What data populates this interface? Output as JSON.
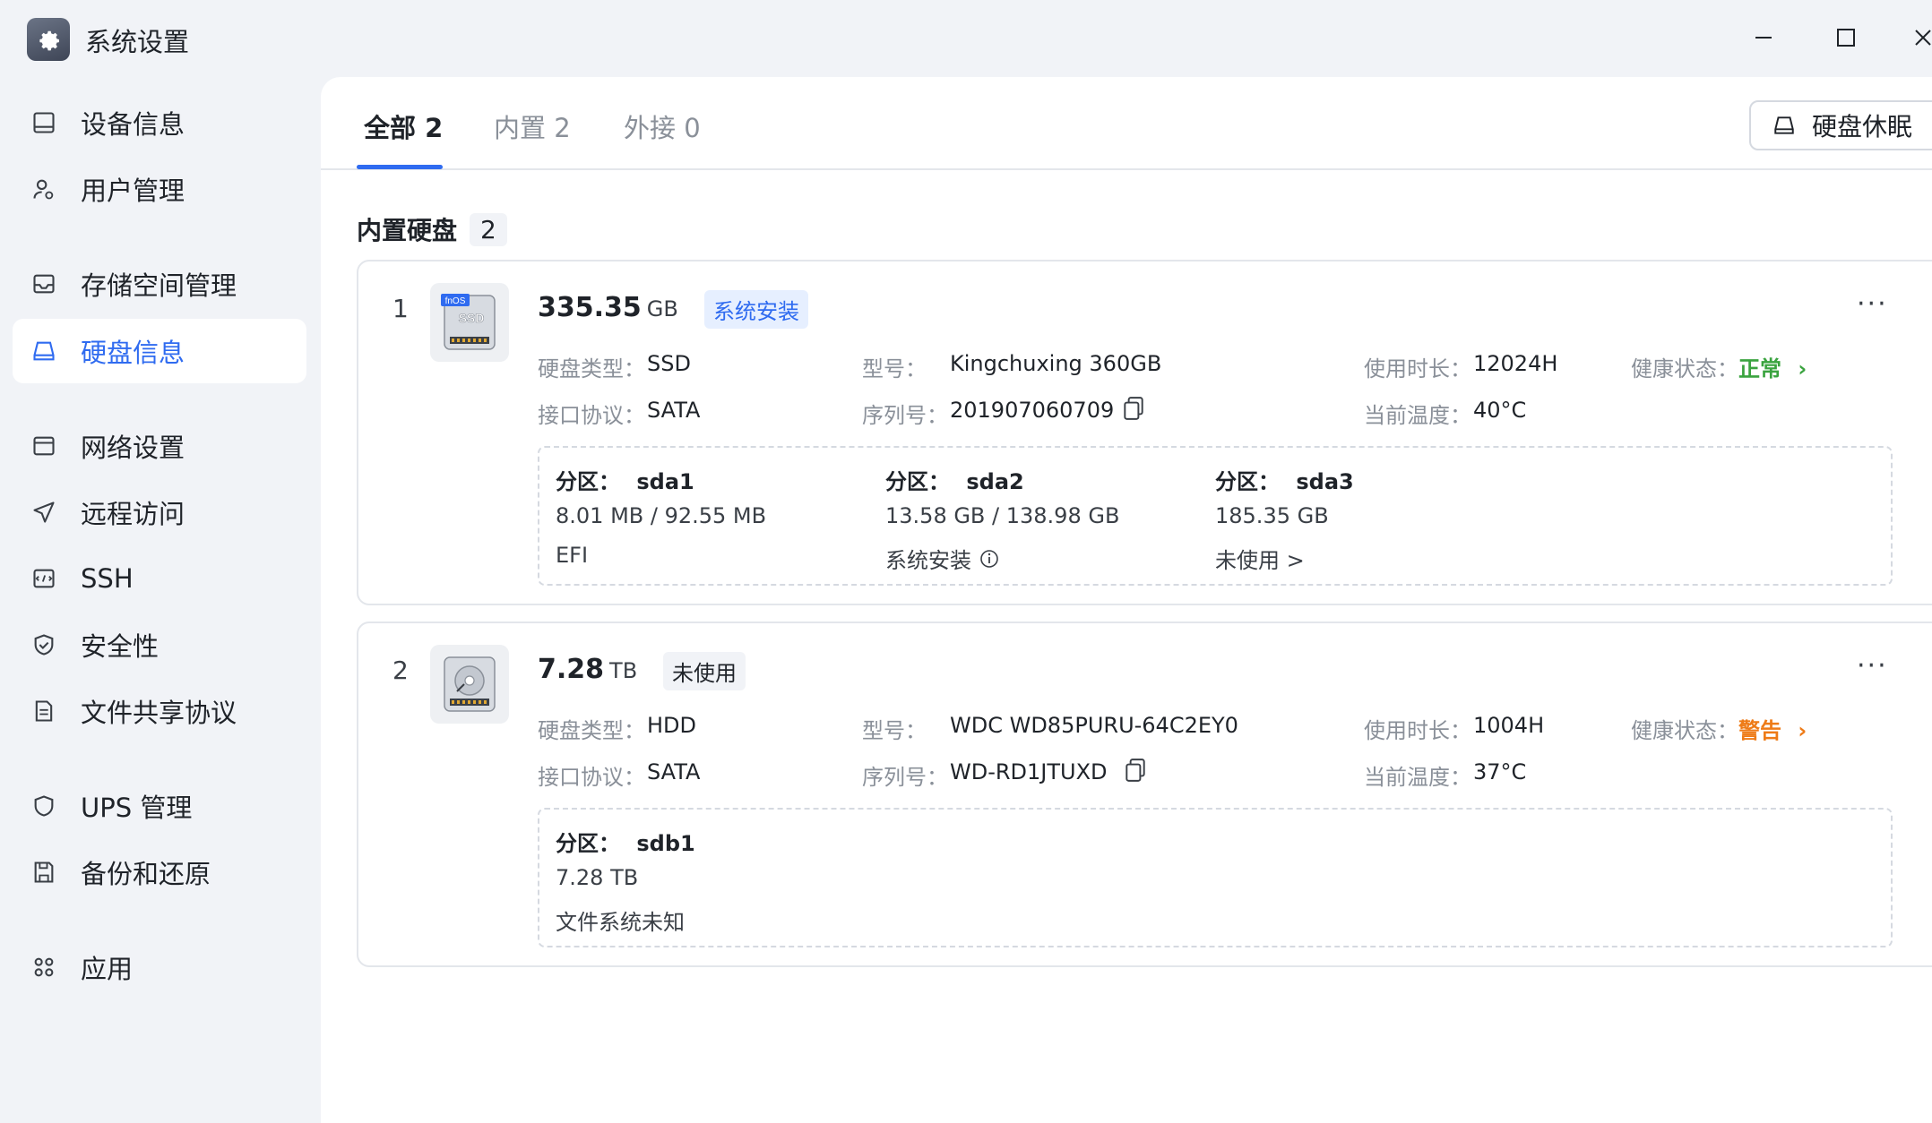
{
  "window": {
    "title": "系统设置"
  },
  "sidebar": {
    "items": [
      {
        "label": "设备信息",
        "icon": "monitor-icon"
      },
      {
        "label": "用户管理",
        "icon": "user-icon"
      },
      {
        "label": "存储空间管理",
        "icon": "storage-icon"
      },
      {
        "label": "硬盘信息",
        "icon": "disk-icon",
        "active": true
      },
      {
        "label": "网络设置",
        "icon": "network-icon"
      },
      {
        "label": "远程访问",
        "icon": "send-icon"
      },
      {
        "label": "SSH",
        "icon": "terminal-icon"
      },
      {
        "label": "安全性",
        "icon": "shield-check-icon"
      },
      {
        "label": "文件共享协议",
        "icon": "document-icon"
      },
      {
        "label": "UPS 管理",
        "icon": "shield-icon"
      },
      {
        "label": "备份和还原",
        "icon": "backup-icon"
      },
      {
        "label": "应用",
        "icon": "apps-icon"
      }
    ]
  },
  "tabs": [
    {
      "label": "全部 2",
      "active": true
    },
    {
      "label": "内置 2"
    },
    {
      "label": "外接 0"
    }
  ],
  "toolbar": {
    "sleep_label": "硬盘休眠"
  },
  "section": {
    "title": "内置硬盘",
    "count": "2"
  },
  "labels": {
    "type": "硬盘类型：",
    "model": "型号：",
    "uptime": "使用时长：",
    "health": "健康状态：",
    "interface": "接口协议：",
    "serial": "序列号：",
    "temp": "当前温度：",
    "partition": "分区：",
    "more": "···",
    "chevron": "›"
  },
  "disks": [
    {
      "index": "1",
      "image_label": "fnOS",
      "image_sub": "SSD",
      "capacity": "335.35",
      "unit": "GB",
      "tag": "系统安装",
      "type": "SSD",
      "model": "Kingchuxing 360GB",
      "uptime": "12024H",
      "health": "正常",
      "interface": "SATA",
      "serial": "201907060709",
      "temp": "40°C",
      "partitions": [
        {
          "name": "sda1",
          "usage": "8.01 MB / 92.55 MB",
          "fs": "EFI"
        },
        {
          "name": "sda2",
          "usage": "13.58 GB / 138.98 GB",
          "fs": "系统安装"
        },
        {
          "name": "sda3",
          "usage": "185.35 GB",
          "fs": "未使用 >"
        }
      ]
    },
    {
      "index": "2",
      "capacity": "7.28",
      "unit": "TB",
      "tag": "未使用",
      "type": "HDD",
      "model": "WDC WD85PURU-64C2EY0",
      "uptime": "1004H",
      "health": "警告",
      "interface": "SATA",
      "serial": "WD-RD1JTUXD",
      "temp": "37°C",
      "partitions": [
        {
          "name": "sdb1",
          "usage": "7.28 TB",
          "fs": "文件系统未知"
        }
      ]
    }
  ],
  "colors": {
    "accent": "#2f6bf0",
    "ok": "#3aa33f",
    "warn": "#ee7b17"
  }
}
